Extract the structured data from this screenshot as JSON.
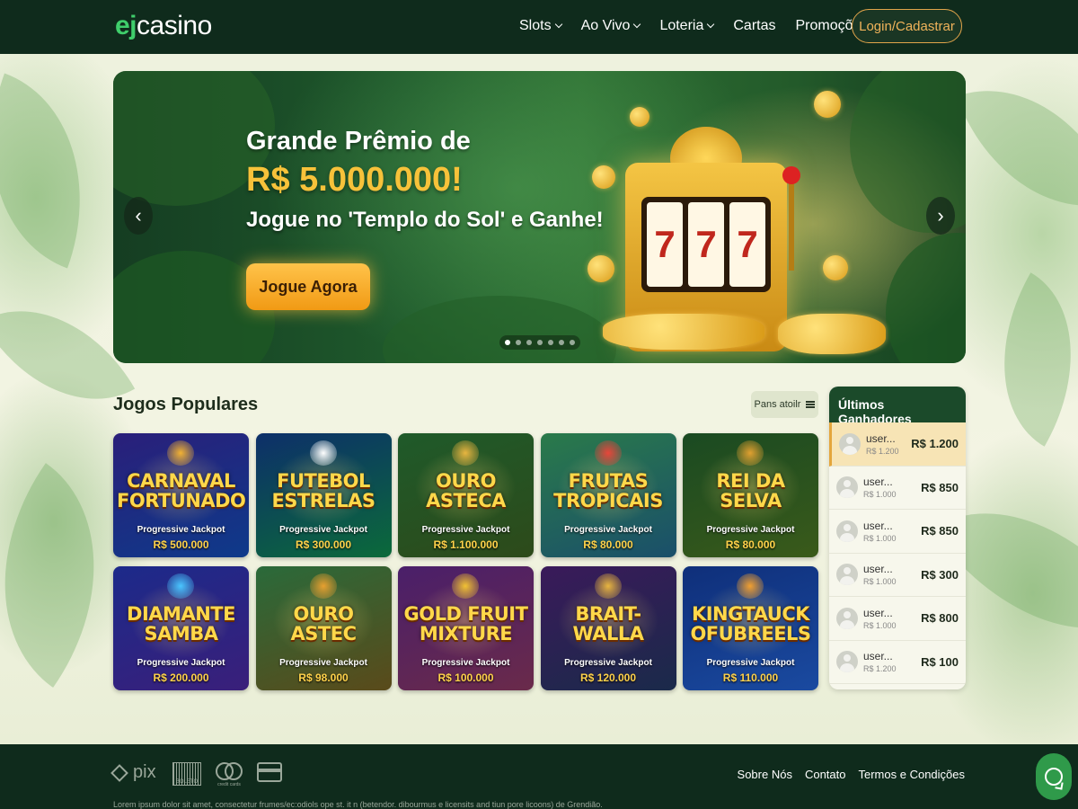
{
  "brand": {
    "logo_prefix": "ej",
    "logo_suffix": "casino"
  },
  "nav": {
    "items": [
      {
        "label": "Slots",
        "has_dropdown": true
      },
      {
        "label": "Ao Vivo",
        "has_dropdown": true
      },
      {
        "label": "Loteria",
        "has_dropdown": true
      },
      {
        "label": "Cartas",
        "has_dropdown": false
      },
      {
        "label": "Promoções",
        "has_dropdown": false
      }
    ],
    "login_label": "Login/Cadastrar"
  },
  "hero": {
    "title_line1": "Grande Prêmio de",
    "title_line2": "R$ 5.000.000!",
    "subtitle": "Jogue no 'Templo do Sol' e Ganhe!",
    "cta": "Jogue Agora",
    "prev": "‹",
    "next": "›",
    "slide_count": 7,
    "active_slide": 1,
    "reel_symbols": [
      "7",
      "7",
      "7"
    ]
  },
  "popular": {
    "title": "Jogos Populares",
    "filter_label": "Pans atoilr",
    "games": [
      {
        "name": "CARNAVAL FORTUNADO",
        "label": "Progressive Jackpot",
        "amount": "R$ 500.000",
        "bg1": "#2a1f7a",
        "bg2": "#0e3a8a",
        "accent": "#f2b233"
      },
      {
        "name": "FUTEBOL ESTRELAS",
        "label": "Progressive Jackpot",
        "amount": "R$ 300.000",
        "bg1": "#0d2f6a",
        "bg2": "#0b6a3a",
        "accent": "#ffffff"
      },
      {
        "name": "OURO ASTECA",
        "label": "Progressive Jackpot",
        "amount": "R$ 1.100.000",
        "bg1": "#1f5a2a",
        "bg2": "#2d4a1a",
        "accent": "#e8b540"
      },
      {
        "name": "FRUTAS TROPICAIS",
        "label": "Progressive Jackpot",
        "amount": "R$ 80.000",
        "bg1": "#2a7a4a",
        "bg2": "#1a4f6a",
        "accent": "#e8463a"
      },
      {
        "name": "REI DA SELVA",
        "label": "Progressive Jackpot",
        "amount": "R$ 80.000",
        "bg1": "#1a4a22",
        "bg2": "#3a5a1a",
        "accent": "#e0a030"
      },
      {
        "name": "DIAMANTE SAMBA",
        "label": "Progressive Jackpot",
        "amount": "R$ 200.000",
        "bg1": "#1c2a8a",
        "bg2": "#3a1f7a",
        "accent": "#4ac6ff"
      },
      {
        "name": "OURO ASTEC",
        "label": "Progressive Jackpot",
        "amount": "R$ 98.000",
        "bg1": "#2a6a3a",
        "bg2": "#5a4a1a",
        "accent": "#e8a030"
      },
      {
        "name": "GOLD FRUIT MIXTURE",
        "label": "Progressive Jackpot",
        "amount": "R$ 100.000",
        "bg1": "#4a1f6a",
        "bg2": "#6a2a4a",
        "accent": "#f2c233"
      },
      {
        "name": "BRAIT-WALLA",
        "label": "Progressive Jackpot",
        "amount": "R$ 120.000",
        "bg1": "#3a1a5a",
        "bg2": "#1a2a4a",
        "accent": "#e8b540"
      },
      {
        "name": "KINGTAUCK OFUBREELS",
        "label": "Progressive Jackpot",
        "amount": "R$ 110.000",
        "bg1": "#0f2f7a",
        "bg2": "#1a4aa0",
        "accent": "#f2a030"
      }
    ]
  },
  "winners": {
    "title": "Últimos Ganhadores",
    "rows": [
      {
        "user": "user...",
        "sub": "R$ 1.200",
        "amount": "R$ 1.200",
        "highlight": true
      },
      {
        "user": "user...",
        "sub": "R$ 1.000",
        "amount": "R$ 850",
        "highlight": false
      },
      {
        "user": "user...",
        "sub": "R$ 1.000",
        "amount": "R$ 850",
        "highlight": false
      },
      {
        "user": "user...",
        "sub": "R$ 1.000",
        "amount": "R$ 300",
        "highlight": false
      },
      {
        "user": "user...",
        "sub": "R$ 1.000",
        "amount": "R$ 800",
        "highlight": false
      },
      {
        "user": "user...",
        "sub": "R$ 1.200",
        "amount": "R$ 100",
        "highlight": false
      }
    ]
  },
  "footer": {
    "payments": {
      "pix": "pix",
      "boleto": "BOLETO",
      "credit": "credit cards"
    },
    "links": [
      "Sobre Nós",
      "Contato",
      "Termos e Condições"
    ],
    "disclaimer": "Lorem ipsum dolor sit amet, consectetur frumes/ec:odiols ope st. it n (betendor. dibourmus e licensits and tiun pore licoons) de Grendião."
  },
  "colors": {
    "nav_bg": "#0f2b1c",
    "accent_green": "#3fce6b",
    "gold": "#f7c23a",
    "login_border": "#e0a44a"
  },
  "icons": {
    "chat": "chat-bubble-icon",
    "filter": "list-filter-icon"
  }
}
